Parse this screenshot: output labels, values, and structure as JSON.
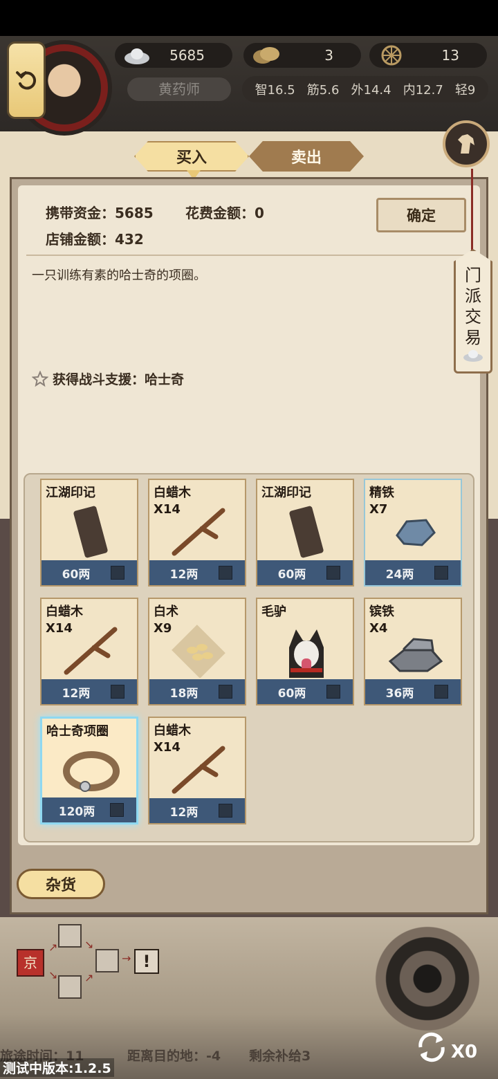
{
  "header": {
    "silver": "5685",
    "coins": "3",
    "wheel": "13",
    "character_name": "黄药师",
    "stats": [
      "智16.5",
      "筋5.6",
      "外14.4",
      "内12.7",
      "轻9"
    ]
  },
  "tabs": {
    "buy": "买入",
    "sell": "卖出"
  },
  "panel": {
    "carry_funds": "携带资金：5685",
    "spend_amount": "花费金额：0",
    "shop_funds": "店铺金额：432",
    "confirm": "确定",
    "description": "一只训练有素的哈士奇的项圈。",
    "effect": "获得战斗支援：哈士奇"
  },
  "side_tag": {
    "chars": [
      "门",
      "派",
      "交",
      "易"
    ]
  },
  "items": [
    {
      "name": "江湖印记",
      "qty": "",
      "price": "60两"
    },
    {
      "name": "白蜡木",
      "qty": "X14",
      "price": "12两"
    },
    {
      "name": "江湖印记",
      "qty": "",
      "price": "60两"
    },
    {
      "name": "精铁",
      "qty": "X7",
      "price": "24两"
    },
    {
      "name": "白蜡木",
      "qty": "X14",
      "price": "12两"
    },
    {
      "name": "白术",
      "qty": "X9",
      "price": "18两"
    },
    {
      "name": "毛驴",
      "qty": "",
      "price": "60两"
    },
    {
      "name": "镔铁",
      "qty": "X4",
      "price": "36两"
    },
    {
      "name": "哈士奇项圈",
      "qty": "",
      "price": "120两"
    },
    {
      "name": "白蜡木",
      "qty": "X14",
      "price": "12两"
    }
  ],
  "misc_button": "杂货",
  "map": {
    "start_glyph": "京",
    "alert": "!"
  },
  "footer": {
    "travel_time": "旅途时间：11",
    "distance": "距离目的地：-4",
    "supplies": "剩余补给3",
    "version": "测试中版本:1.2.5",
    "refresh_count": "X0"
  }
}
